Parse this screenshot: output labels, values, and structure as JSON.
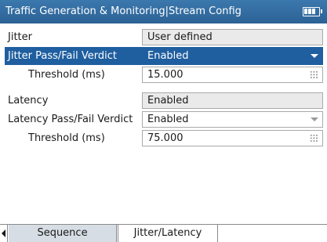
{
  "title_bar": {
    "title": "Traffic Generation & Monitoring|Stream Config",
    "icon": "battery-icon"
  },
  "config": {
    "rows": [
      {
        "label": "Jitter",
        "value": "User defined",
        "field": "read-only"
      },
      {
        "label": "Jitter Pass/Fail Verdict",
        "value": "Enabled",
        "field": "dropdown",
        "selected": true
      },
      {
        "label": "Threshold (ms)",
        "value": "15.000",
        "field": "numeric-input"
      },
      {
        "label": "Latency",
        "value": "Enabled",
        "field": "read-only"
      },
      {
        "label": "Latency Pass/Fail Verdict",
        "value": "Enabled",
        "field": "dropdown"
      },
      {
        "label": "Threshold (ms)",
        "value": "75.000",
        "field": "numeric-input"
      }
    ]
  },
  "tabs": {
    "items": [
      {
        "label": "Sequence",
        "active": false
      },
      {
        "label": "Jitter/Latency",
        "active": true
      }
    ]
  },
  "colors": {
    "title_bar": "#2f6a9f",
    "selection": "#1f5fa0",
    "read_only_field": "#eaeaea",
    "inactive_tab": "#d6dde4"
  }
}
